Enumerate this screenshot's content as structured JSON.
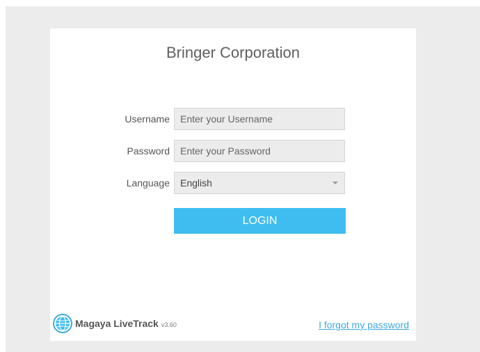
{
  "company_title": "Bringer Corporation",
  "form": {
    "username_label": "Username",
    "username_placeholder": "Enter your Username",
    "password_label": "Password",
    "password_placeholder": "Enter your Password",
    "language_label": "Language",
    "language_value": "English",
    "login_label": "LOGIN"
  },
  "footer": {
    "logo_icon": "globe-icon",
    "brand_name": "Magaya LiveTrack",
    "version": "v3.60",
    "forgot_password": "I forgot my password"
  },
  "colors": {
    "accent": "#3fbdf0",
    "link": "#3fa9e0",
    "background": "#ececec"
  }
}
